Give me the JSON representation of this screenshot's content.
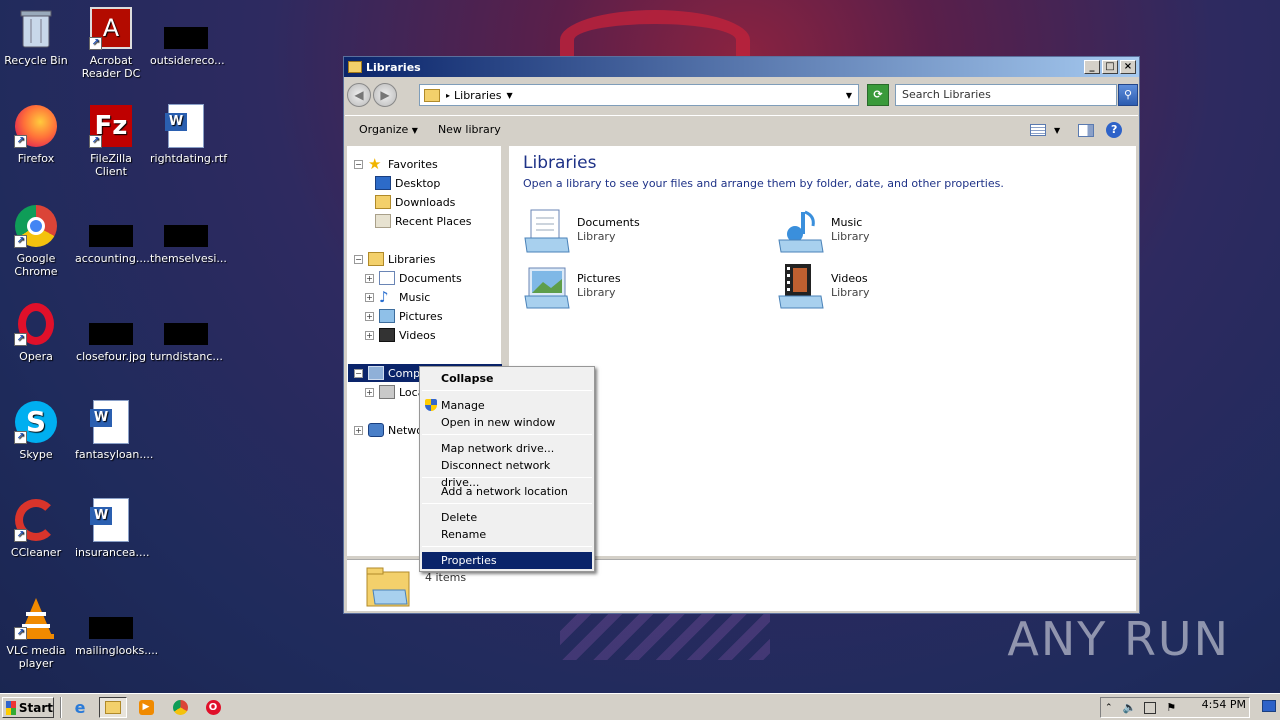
{
  "desktop": {
    "icons": [
      {
        "label": "Recycle Bin",
        "icon": "recycle-bin-icon"
      },
      {
        "label": "Acrobat Reader DC",
        "icon": "acrobat-icon"
      },
      {
        "label": "outsidereco...",
        "icon": "file-thumbnail"
      },
      {
        "label": "Firefox",
        "icon": "firefox-icon"
      },
      {
        "label": "FileZilla Client",
        "icon": "filezilla-icon"
      },
      {
        "label": "rightdating.rtf",
        "icon": "word-doc-icon"
      },
      {
        "label": "Google Chrome",
        "icon": "chrome-icon"
      },
      {
        "label": "accounting....",
        "icon": "file-thumbnail"
      },
      {
        "label": "themselvesi...",
        "icon": "file-thumbnail"
      },
      {
        "label": "Opera",
        "icon": "opera-icon"
      },
      {
        "label": "closefour.jpg",
        "icon": "file-thumbnail"
      },
      {
        "label": "turndistanc...",
        "icon": "file-thumbnail"
      },
      {
        "label": "Skype",
        "icon": "skype-icon"
      },
      {
        "label": "fantasyloan....",
        "icon": "word-doc-icon"
      },
      {
        "label": "CCleaner",
        "icon": "ccleaner-icon"
      },
      {
        "label": "insurancea....",
        "icon": "word-doc-icon"
      },
      {
        "label": "VLC media player",
        "icon": "vlc-icon"
      },
      {
        "label": "mailinglooks....",
        "icon": "file-thumbnail"
      }
    ]
  },
  "window": {
    "title": "Libraries",
    "address": "Libraries",
    "search_placeholder": "Search Libraries",
    "toolbar": {
      "organize": "Organize",
      "new_library": "New library"
    },
    "nav": {
      "favorites": "Favorites",
      "desktop": "Desktop",
      "downloads": "Downloads",
      "recent": "Recent Places",
      "libraries": "Libraries",
      "documents": "Documents",
      "music": "Music",
      "pictures": "Pictures",
      "videos": "Videos",
      "computer": "Compu",
      "local": "Loca",
      "network": "Netwo"
    },
    "content": {
      "heading": "Libraries",
      "subtitle": "Open a library to see your files and arrange them by folder, date, and other properties.",
      "libraries": [
        {
          "name": "Documents",
          "type": "Library"
        },
        {
          "name": "Music",
          "type": "Library"
        },
        {
          "name": "Pictures",
          "type": "Library"
        },
        {
          "name": "Videos",
          "type": "Library"
        }
      ]
    },
    "details": {
      "count": "4 items"
    }
  },
  "context_menu": {
    "collapse": "Collapse",
    "manage": "Manage",
    "open_new": "Open in new window",
    "map_drive": "Map network drive...",
    "disconnect": "Disconnect network drive...",
    "add_location": "Add a network location",
    "delete": "Delete",
    "rename": "Rename",
    "properties": "Properties"
  },
  "taskbar": {
    "start": "Start",
    "clock": "4:54 PM"
  },
  "watermark": "ANY RUN",
  "colors": {
    "selection": "#0a246a",
    "title_gradient_start": "#0a246a",
    "heading": "#1e3287"
  }
}
